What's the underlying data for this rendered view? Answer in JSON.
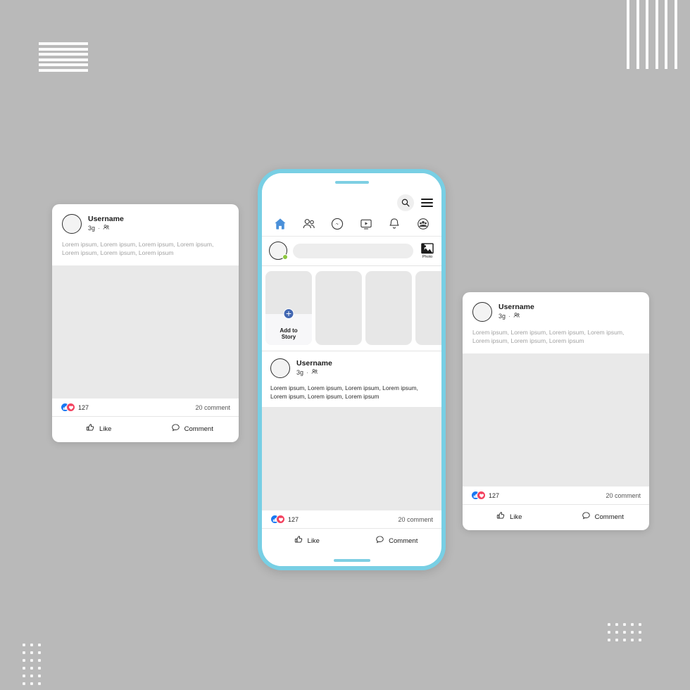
{
  "background": {
    "color": "#b9b9b9",
    "accent_phone": "#78cfe4",
    "accent_blue": "#1877f2",
    "accent_love": "#f3425f",
    "online_green": "#8cc63e"
  },
  "decorations": {
    "horizontal_lines_count": 6,
    "vertical_lines_count": 6,
    "dot_grid_bottom_left": {
      "cols": 3,
      "rows": 6
    },
    "dot_grid_bottom_right": {
      "cols": 5,
      "rows": 3
    }
  },
  "phone": {
    "topbar": {
      "search_icon": "search-icon",
      "menu_icon": "hamburger-menu-icon"
    },
    "nav": [
      {
        "name": "home-icon",
        "label": "Home",
        "active": true
      },
      {
        "name": "friends-icon",
        "label": "Friends",
        "active": false
      },
      {
        "name": "messenger-icon",
        "label": "Messenger",
        "active": false
      },
      {
        "name": "watch-video-icon",
        "label": "Watch",
        "active": false
      },
      {
        "name": "notifications-bell-icon",
        "label": "Notifications",
        "active": false
      },
      {
        "name": "groups-profile-icon",
        "label": "Groups",
        "active": false
      }
    ],
    "composer": {
      "placeholder": "",
      "value": "",
      "photo_label": "Photo",
      "photo_icon": "photo-image-icon",
      "avatar_icon": "avatar-circle",
      "status": "online"
    },
    "stories": {
      "add_story_label_line1": "Add to",
      "add_story_label_line2": "Story",
      "add_icon": "plus-circle-icon",
      "placeholder_count": 3
    },
    "post": {
      "username": "Username",
      "time": "3g",
      "separator": "·",
      "audience_icon": "friends-audience-icon",
      "text": "Lorem ipsum, Lorem ipsum, Lorem ipsum, Lorem ipsum, Lorem ipsum, Lorem ipsum, Lorem ipsum",
      "reaction_count": "127",
      "comment_count": "20 comment",
      "like_label": "Like",
      "comment_label": "Comment",
      "like_icon": "thumbs-up-icon",
      "comment_icon": "comment-bubble-icon",
      "reaction_like_icon": "reaction-like-badge",
      "reaction_love_icon": "reaction-love-badge"
    }
  },
  "card_left": {
    "username": "Username",
    "time": "3g",
    "separator": "·",
    "audience_icon": "friends-audience-icon",
    "text": "Lorem ipsum, Lorem ipsum, Lorem ipsum, Lorem ipsum, Lorem ipsum, Lorem ipsum, Lorem ipsum",
    "reaction_count": "127",
    "comment_count": "20 comment",
    "like_label": "Like",
    "comment_label": "Comment"
  },
  "card_right": {
    "username": "Username",
    "time": "3g",
    "separator": "·",
    "audience_icon": "friends-audience-icon",
    "text": "Lorem ipsum, Lorem ipsum, Lorem ipsum, Lorem ipsum, Lorem ipsum, Lorem ipsum, Lorem ipsum",
    "reaction_count": "127",
    "comment_count": "20 comment",
    "like_label": "Like",
    "comment_label": "Comment"
  }
}
